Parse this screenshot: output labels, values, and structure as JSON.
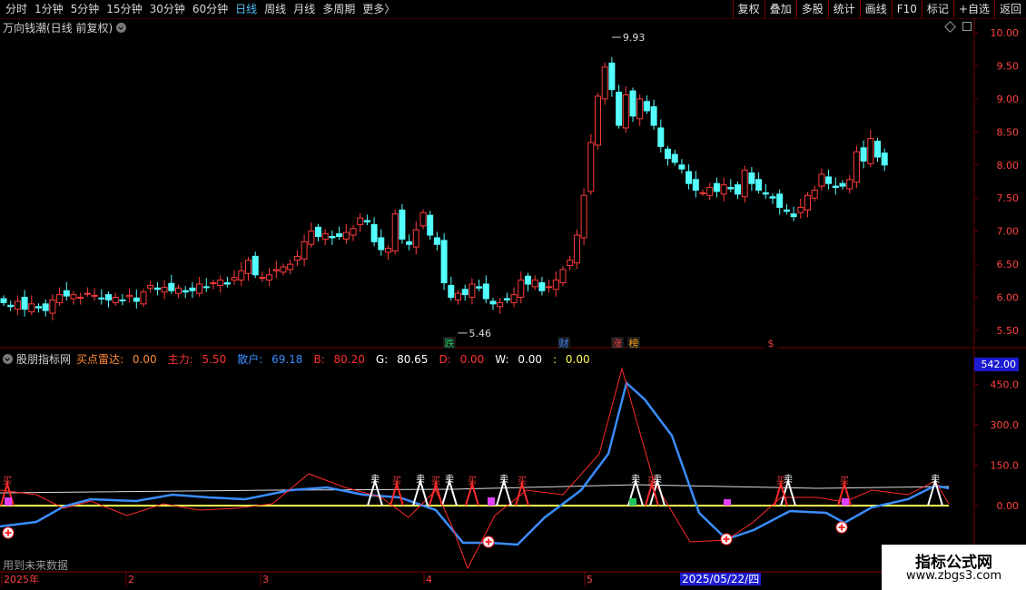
{
  "toolbar": {
    "periods": [
      "分时",
      "1分钟",
      "5分钟",
      "15分钟",
      "30分钟",
      "60分钟",
      "日线",
      "周线",
      "月线",
      "多周期",
      "更多"
    ],
    "active": "日线",
    "more_glyph": "〉",
    "right_buttons": [
      "复权",
      "叠加",
      "多股",
      "统计",
      "画线",
      "F10",
      "标记",
      "+自选",
      "返回"
    ]
  },
  "main_panel": {
    "title": "万向钱潮(日线 前复权)",
    "price_axis": [
      "10.00",
      "9.50",
      "9.00",
      "8.50",
      "8.00",
      "7.50",
      "7.00",
      "6.50",
      "6.00",
      "5.50"
    ],
    "high_label": "9.93",
    "low_label": "5.46",
    "badges": [
      {
        "text": "跌",
        "color": "#22c55e"
      },
      {
        "text": "财",
        "color": "#3b82f6"
      },
      {
        "text": "涨",
        "color": "#ef4444"
      },
      {
        "text": "榜",
        "color": "#f59e0b"
      },
      {
        "text": "$",
        "color": "#ef4444"
      }
    ]
  },
  "indicator_panel": {
    "name": "股朋指标网",
    "params": [
      {
        "label": "买点雷达:",
        "value": "0.00",
        "color": "#ff8c3a"
      },
      {
        "label": "主力:",
        "value": "5.50",
        "color": "#ff3030"
      },
      {
        "label": "散户:",
        "value": "69.18",
        "color": "#3a8dff"
      },
      {
        "label": "B:",
        "value": "80.20",
        "color": "#ff3030"
      },
      {
        "label": "G:",
        "value": "80.65",
        "color": "#ffffff"
      },
      {
        "label": "D:",
        "value": "0.00",
        "color": "#ff3030"
      },
      {
        "label": "W:",
        "value": "0.00",
        "color": "#ffffff"
      },
      {
        "label": ":",
        "value": "0.00",
        "color": "#ffff55"
      }
    ],
    "axis_box": "542.00",
    "axis_labels": [
      "450.0",
      "300.0",
      "150.0",
      "0.00"
    ],
    "buy_label": "买",
    "sell_label": "卖",
    "note": "用到未来数据"
  },
  "time_axis": {
    "labels": [
      "2025年",
      "2",
      "3",
      "4",
      "5"
    ],
    "selected_date": "2025/05/22/四"
  },
  "watermark": {
    "line1": "指标公式网",
    "line2": "www.zbgs3.com"
  },
  "colors": {
    "up": "#ff3b3b",
    "down": "#54ffff",
    "bg": "#000000",
    "grid": "#7a0000",
    "blue_line": "#3a8dff"
  }
}
